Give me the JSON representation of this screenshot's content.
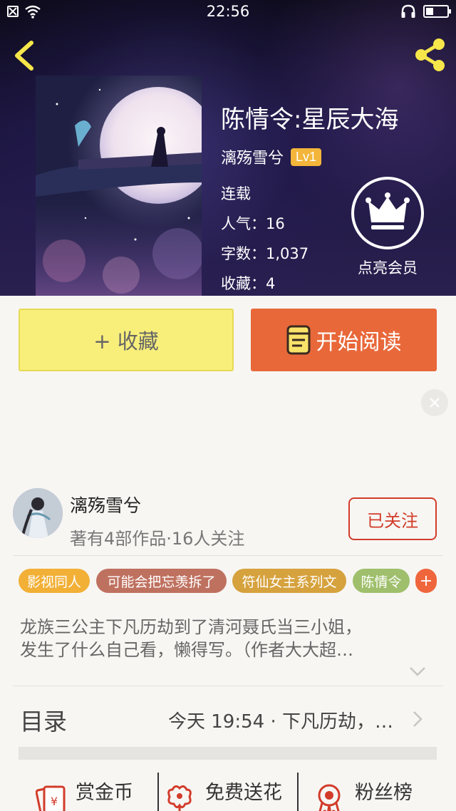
{
  "status_bar": {
    "time": "22:56"
  },
  "book": {
    "title": "陈情令:星辰大海",
    "author": "漓殇雪兮",
    "level": "Lv1",
    "status": "连载",
    "popularity": "人气：16",
    "word_count": "字数：1,037",
    "favorites": "收藏：4",
    "vip_label": "点亮会员"
  },
  "actions": {
    "favorite_label": "+ 收藏",
    "read_label": "开始阅读"
  },
  "author_card": {
    "name": "漓殇雪兮",
    "subtitle": "著有4部作品·16人关注",
    "follow_label": "已关注"
  },
  "tags": [
    {
      "label": "影视同人",
      "color": "#f2b037"
    },
    {
      "label": "可能会把忘羡拆了",
      "color": "#bf7160"
    },
    {
      "label": "符仙女主系列文",
      "color": "#d6a23e"
    },
    {
      "label": "陈情令",
      "color": "#9fbf6c"
    },
    {
      "label": "+",
      "color": "#f0663c"
    }
  ],
  "description": {
    "line1": "龙族三公主下凡历劫到了清河聂氏当三小姐，",
    "line2": "发生了什么自己看，懒得写。（作者大大超…"
  },
  "catalog": {
    "title": "目录",
    "latest": "今天 19:54 · 下凡历劫，…"
  },
  "features": [
    {
      "label": "赏金币",
      "icon": "red-envelope-icon"
    },
    {
      "label": "免费送花",
      "icon": "flower-icon"
    },
    {
      "label": "粉丝榜",
      "icon": "medal-icon"
    }
  ],
  "colors": {
    "accent_orange": "#e8683a",
    "favorite_yellow": "#f8ef7b",
    "follow_red": "#d23c2a",
    "icon_yellow": "#f7e64a"
  }
}
